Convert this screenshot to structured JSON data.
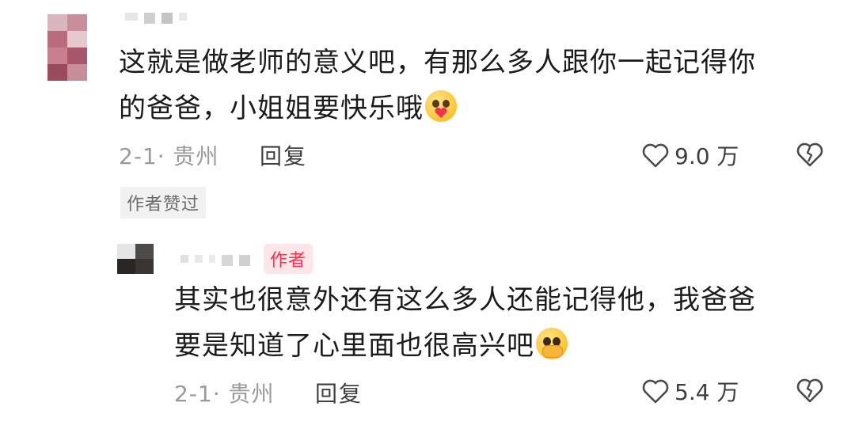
{
  "comment": {
    "text_line1": "这就是做老师的意义吧，有那么多人跟你一起记得你",
    "text_line2": "的爸爸，小姐姐要快乐哦",
    "emoji": "heart-hug-emoji",
    "date": "2-1",
    "location": "贵州",
    "reply_label": "回复",
    "likes": "9.0 万",
    "author_liked_label": "作者赞过"
  },
  "reply": {
    "author_badge": "作者",
    "text_line1": "其实也很意外还有这么多人还能记得他，我爸爸",
    "text_line2": "要是知道了心里面也很高兴吧",
    "emoji": "pleading-face-emoji",
    "date": "2-1",
    "location": "贵州",
    "reply_label": "回复",
    "likes": "5.4 万"
  },
  "colors": {
    "accent": "#ff2e4d",
    "meta": "#9a9a9a",
    "text": "#1b1b1b"
  }
}
